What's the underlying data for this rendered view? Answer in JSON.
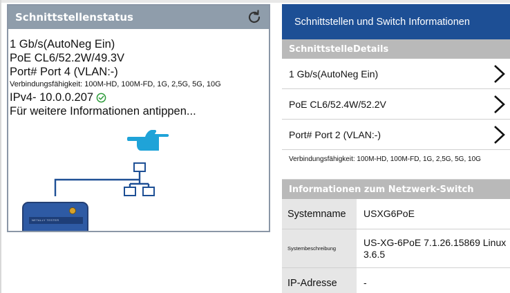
{
  "status_card": {
    "title": "Schnittstellenstatus",
    "link_speed": "1 Gb/s(AutoNeg Ein)",
    "poe": "PoE CL6/52.2W/49.3V",
    "port": "Port# Port 4 (VLAN:-)",
    "capability": "Verbindungsfähigkeit: 100M-HD, 100M-FD, 1G, 2,5G, 5G, 10G",
    "ipv4": "IPv4- 10.0.0.207",
    "tap_hint": "Für weitere Informationen antippen...",
    "device_brand": "NETALLY TESTER",
    "colors": {
      "header": "#8f9dab",
      "network_line": "#1d4f95",
      "check": "#2d9b3a",
      "hand": "#1fa3d8"
    }
  },
  "info_panel": {
    "header": "Schnittstellen und Switch Informationen",
    "details_section": "SchnittstelleDetails",
    "details_rows": [
      "1 Gb/s(AutoNeg Ein)",
      "PoE CL6/52.4W/52.2V",
      "Port# Port 2 (VLAN:-)"
    ],
    "capability": "Verbindungsfähigkeit: 100M-HD, 100M-FD, 1G, 2,5G, 5G, 10G",
    "switch_section": "Informationen zum Netzwerk-Switch",
    "switch_rows": [
      {
        "label": "Systemname",
        "value": "USXG6PoE"
      },
      {
        "label": "Systembeschreibung",
        "value": "US-XG-6PoE 7.1.26.15869 Linux\n3.6.5"
      },
      {
        "label": "IP-Adresse",
        "value": "-"
      }
    ],
    "colors": {
      "header": "#1d4f95",
      "section": "#b9b9b9"
    }
  }
}
